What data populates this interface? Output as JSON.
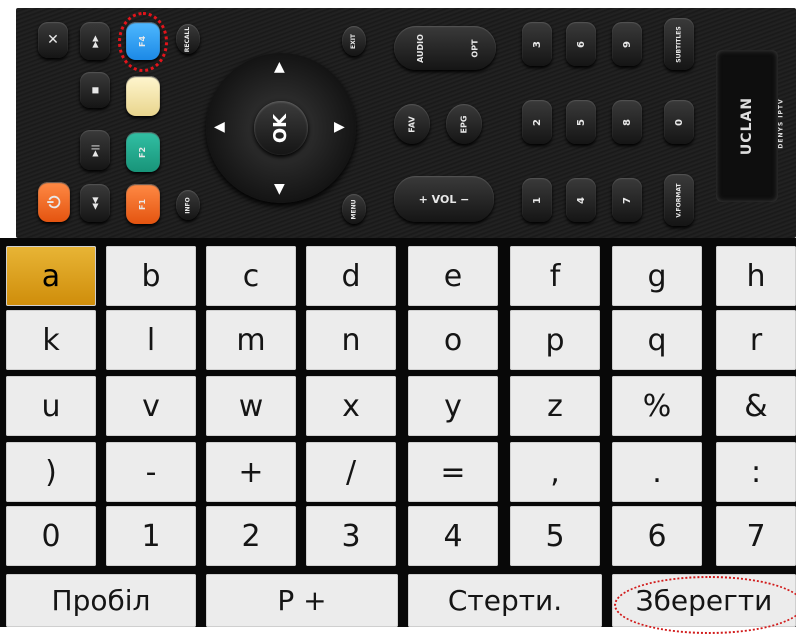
{
  "remote": {
    "buttons": [
      {
        "name": "mute-button",
        "label": "",
        "x": 0
      },
      {
        "name": "fast-forward-button",
        "label": "▶▶"
      },
      {
        "name": "f4-button",
        "label": "F4"
      },
      {
        "name": "recall-button",
        "label": "RECALL"
      },
      {
        "name": "stop-button",
        "label": "■"
      },
      {
        "name": "yellow-button",
        "label": ""
      },
      {
        "name": "play-pause-button",
        "label": "▶||"
      },
      {
        "name": "f2-button",
        "label": "F2"
      },
      {
        "name": "power-button",
        "label": "⏻"
      },
      {
        "name": "rewind-button",
        "label": "◀◀"
      },
      {
        "name": "f1-button",
        "label": "F1"
      },
      {
        "name": "info-button",
        "label": "INFO"
      },
      {
        "name": "exit-button",
        "label": "EXIT"
      },
      {
        "name": "audio-button",
        "label": "AUDIO"
      },
      {
        "name": "opt-button",
        "label": "OPT"
      },
      {
        "name": "fav-button",
        "label": "FAV"
      },
      {
        "name": "epg-button",
        "label": "EPG"
      },
      {
        "name": "menu-button",
        "label": "MENU"
      },
      {
        "name": "vol-rocker",
        "label": "+   VOL   −"
      },
      {
        "name": "digit-3-button",
        "label": "3"
      },
      {
        "name": "digit-6-button",
        "label": "6"
      },
      {
        "name": "digit-9-button",
        "label": "9"
      },
      {
        "name": "subtitles-button",
        "label": "SUBTITLES"
      },
      {
        "name": "digit-2-button",
        "label": "2"
      },
      {
        "name": "digit-5-button",
        "label": "5"
      },
      {
        "name": "digit-8-button",
        "label": "8"
      },
      {
        "name": "digit-0-button",
        "label": "0"
      },
      {
        "name": "digit-1-button",
        "label": "1"
      },
      {
        "name": "digit-4-button",
        "label": "4"
      },
      {
        "name": "digit-7-button",
        "label": "7"
      },
      {
        "name": "vformat-button",
        "label": "V.FORMAT"
      }
    ],
    "ok_label": "OK",
    "logo_text": "UCLAN",
    "logo_subtext": "DENYS IPTV",
    "highlight_color": "#e3141b"
  },
  "keyboard": {
    "rows": [
      [
        "a",
        "b",
        "c",
        "d",
        "e",
        "f",
        "g",
        "h"
      ],
      [
        "k",
        "l",
        "m",
        "n",
        "o",
        "p",
        "q",
        "r"
      ],
      [
        "u",
        "v",
        "w",
        "x",
        "y",
        "z",
        "%",
        "&"
      ],
      [
        ")",
        "-",
        "+",
        "/",
        "=",
        ",",
        ".",
        ":"
      ],
      [
        "0",
        "1",
        "2",
        "3",
        "4",
        "5",
        "6",
        "7"
      ]
    ],
    "bottom_row": [
      "Пробіл",
      "P +",
      "Стерти.",
      "Зберегти"
    ],
    "selected_key": "a",
    "selected_color": "#e3a21f",
    "highlighted_action": "Зберегти"
  }
}
